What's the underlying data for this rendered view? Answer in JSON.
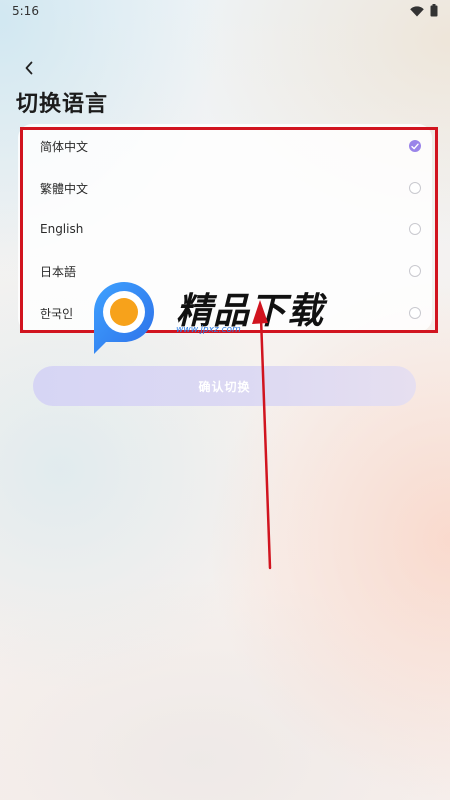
{
  "status_bar": {
    "time": "5:16",
    "icons": [
      "wifi-icon",
      "battery-icon"
    ]
  },
  "header": {
    "back_icon": "chevron-left-icon",
    "title": "切换语言"
  },
  "languages": [
    {
      "label": "简体中文",
      "selected": true
    },
    {
      "label": "繁體中文",
      "selected": false
    },
    {
      "label": "English",
      "selected": false
    },
    {
      "label": "日本語",
      "selected": false
    },
    {
      "label": "한국인",
      "selected": false
    }
  ],
  "confirm_button": {
    "label": "确认切换",
    "enabled": false
  },
  "watermark": {
    "text": "精品下载",
    "url": "www.jpxz.com"
  },
  "colors": {
    "accent": "#9a84e9",
    "highlight_box": "#d1141f",
    "confirm_button": "#d6d5f4"
  }
}
